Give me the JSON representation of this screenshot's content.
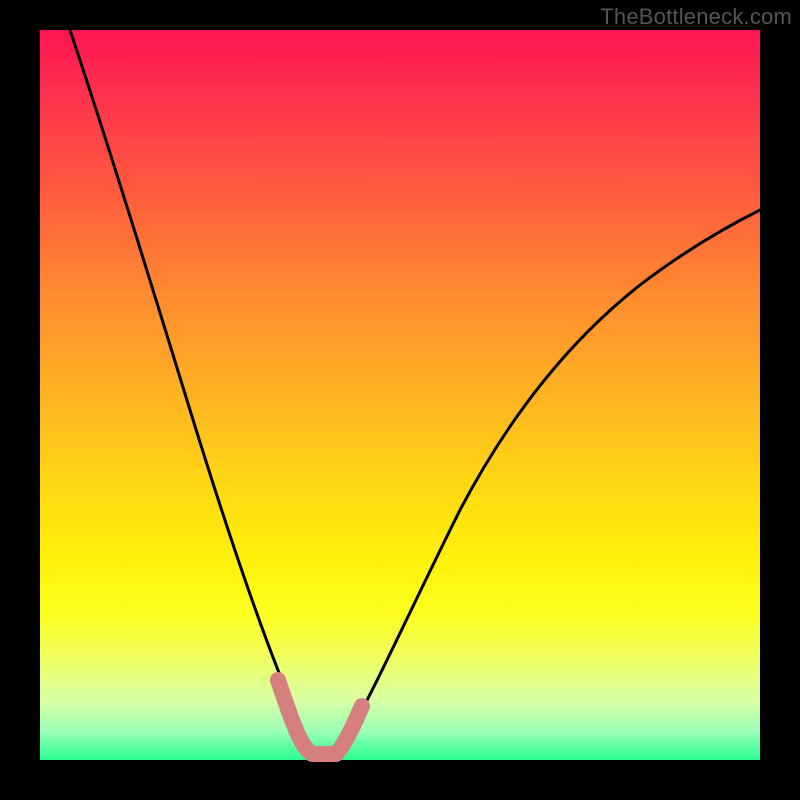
{
  "watermark": "TheBottleneck.com",
  "colors": {
    "background": "#000000",
    "curve": "#000000",
    "bump_stroke": "#d67f7f",
    "gradient_stops": [
      "#ff1452",
      "#ff2f4e",
      "#ff5a3e",
      "#ff8a30",
      "#ffb321",
      "#ffd714",
      "#fff00a",
      "#fbff1f",
      "#f0ff60",
      "#d6ffa6",
      "#9cffb6",
      "#2aff8f"
    ]
  },
  "chart_data": {
    "type": "line",
    "title": "",
    "xlabel": "",
    "ylabel": "",
    "xlim": [
      0,
      100
    ],
    "ylim": [
      0,
      100
    ],
    "series": [
      {
        "name": "left-curve",
        "x": [
          4,
          6,
          8,
          10,
          12,
          14,
          16,
          18,
          20,
          22,
          24,
          26,
          28,
          30,
          32,
          33,
          34,
          35,
          36
        ],
        "y": [
          100,
          92,
          84,
          77,
          70,
          63,
          56,
          49,
          43,
          37,
          31,
          25,
          20,
          15,
          10,
          7,
          5,
          3,
          1
        ]
      },
      {
        "name": "right-curve",
        "x": [
          40,
          42,
          45,
          48,
          52,
          56,
          60,
          65,
          70,
          75,
          80,
          85,
          90,
          95,
          100
        ],
        "y": [
          1,
          3,
          7,
          12,
          18,
          25,
          31,
          38,
          45,
          51,
          57,
          62,
          66,
          70,
          73
        ]
      },
      {
        "name": "bump-overlay",
        "x": [
          32,
          33,
          34,
          35,
          36,
          37,
          38,
          39,
          40,
          41,
          42
        ],
        "y": [
          10,
          7,
          4,
          2,
          1,
          1,
          1,
          1,
          2,
          4,
          6
        ]
      }
    ],
    "annotations": []
  }
}
